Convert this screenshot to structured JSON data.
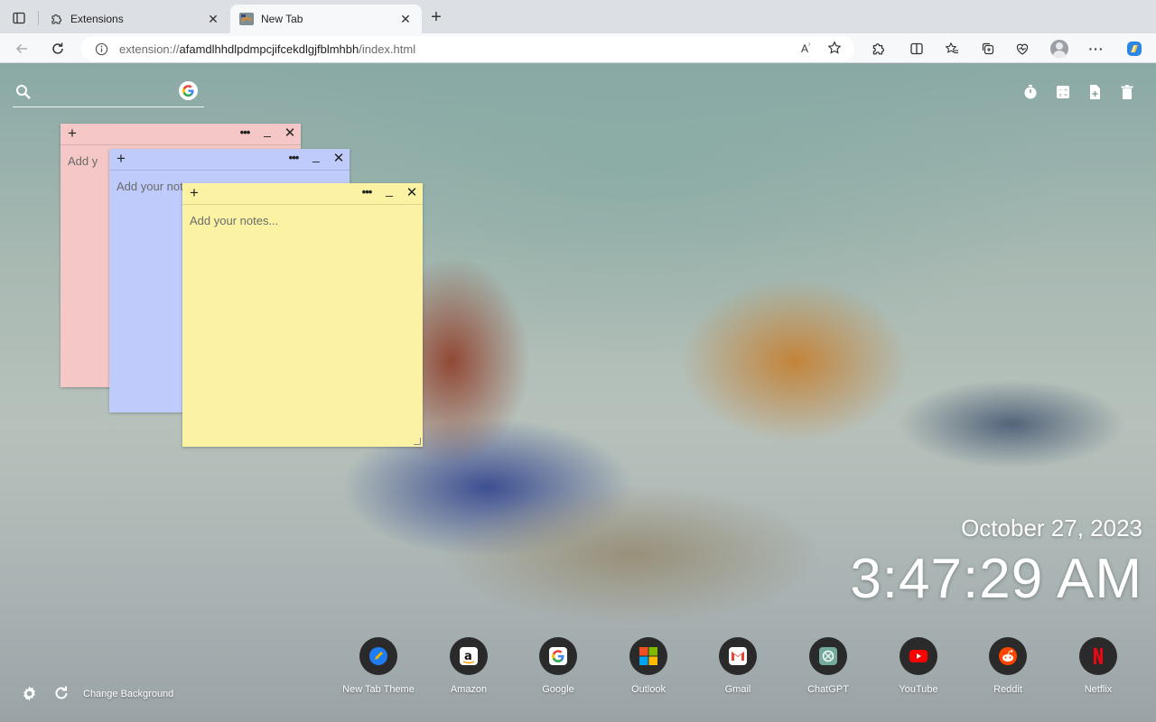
{
  "browser": {
    "tabs": [
      {
        "title": "Extensions",
        "icon": "puzzle-icon",
        "active": false
      },
      {
        "title": "New Tab",
        "icon": "duck-thumbnail-icon",
        "active": true
      }
    ],
    "address_bar": {
      "scheme": "extension://",
      "host": "afamdlhhdlpdmpcjifcekdlgjfblmhbh",
      "path": "/index.html"
    },
    "toolbar_icons": [
      "back-icon",
      "reload-icon",
      "info-icon",
      "read-aloud-icon",
      "favorite-star-icon",
      "extensions-puzzle-icon",
      "split-screen-icon",
      "favorites-icon",
      "collections-icon",
      "browser-essentials-icon",
      "profile-avatar-icon",
      "more-menu-icon",
      "copilot-icon"
    ]
  },
  "newtab": {
    "search": {
      "placeholder": ""
    },
    "tools": [
      "timer-icon",
      "calculator-icon",
      "add-note-icon",
      "trash-icon"
    ],
    "notes": [
      {
        "color": "#f5c7c6",
        "placeholder": "Add your notes..."
      },
      {
        "color": "#bfcbfa",
        "placeholder": "Add your notes..."
      },
      {
        "color": "#fbf3a3",
        "placeholder": "Add your notes..."
      }
    ],
    "date": "October 27, 2023",
    "time": "3:47:29 AM",
    "shortcuts": [
      {
        "label": "New Tab Theme",
        "icon": "new-tab-theme-icon"
      },
      {
        "label": "Amazon",
        "icon": "amazon-icon"
      },
      {
        "label": "Google",
        "icon": "google-icon"
      },
      {
        "label": "Outlook",
        "icon": "microsoft-icon"
      },
      {
        "label": "Gmail",
        "icon": "gmail-icon"
      },
      {
        "label": "ChatGPT",
        "icon": "chatgpt-icon"
      },
      {
        "label": "YouTube",
        "icon": "youtube-icon"
      },
      {
        "label": "Reddit",
        "icon": "reddit-icon"
      },
      {
        "label": "Netflix",
        "icon": "netflix-icon"
      }
    ],
    "change_background": "Change Background"
  }
}
